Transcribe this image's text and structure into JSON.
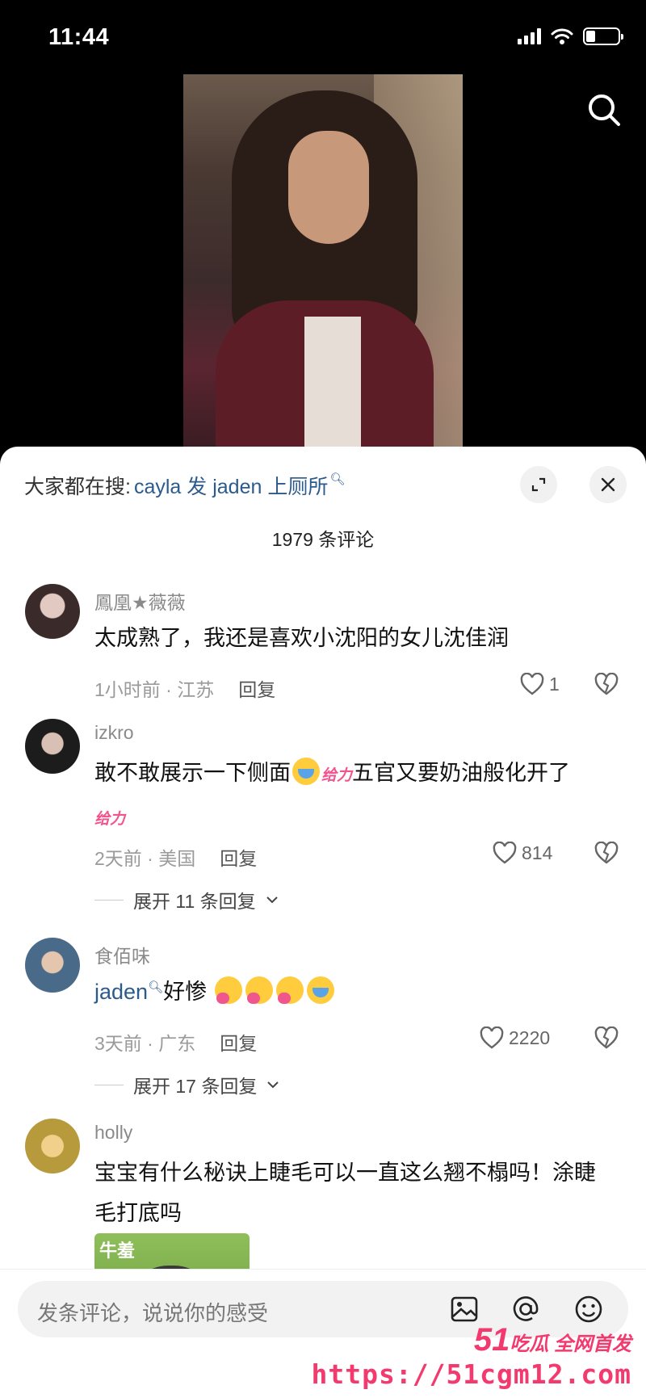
{
  "status_bar": {
    "time": "11:44"
  },
  "sheet": {
    "trending_prefix": "大家都在搜:",
    "trending_query": "cayla 发 jaden 上厕所",
    "comment_count": "1979 条评论"
  },
  "comments": [
    {
      "user": "鳳凰★薇薇",
      "text": "太成熟了，我还是喜欢小沈阳的女儿沈佳润",
      "time_loc": "1小时前 · 江苏",
      "reply": "回复",
      "likes": "1"
    },
    {
      "user": "izkro",
      "text_a": "敢不敢展示一下侧面",
      "text_b": "五官又要奶油般化开了",
      "geili": "给力",
      "time_loc": "2天前 · 美国",
      "reply": "回复",
      "likes": "814",
      "expand": "展开 11 条回复"
    },
    {
      "user": "食佰味",
      "mention": "jaden",
      "text": "好惨",
      "time_loc": "3天前 · 广东",
      "reply": "回复",
      "likes": "2220",
      "expand": "展开 17 条回复"
    },
    {
      "user": "holly",
      "text_line1": "宝宝有什么秘诀上睫毛可以一直这么翘不榻吗！涂睫",
      "text_line2": "毛打底吗",
      "sticker_caption": "牛羞"
    }
  ],
  "input": {
    "placeholder": "发条评论，说说你的感受"
  },
  "watermark": {
    "brand_num": "51",
    "brand_text": "吃瓜 全网首发",
    "url": "https://51cgm12.com"
  },
  "colors": {
    "link": "#2b5a8c",
    "watermark": "#f23a6e",
    "sheet_bg": "#ffffff"
  },
  "icons": [
    "search-icon",
    "expand-icon",
    "close-icon",
    "heart-icon",
    "broken-heart-icon",
    "image-icon",
    "at-icon",
    "emoji-icon",
    "chevron-down-icon",
    "wifi-icon",
    "battery-icon",
    "signal-icon"
  ]
}
